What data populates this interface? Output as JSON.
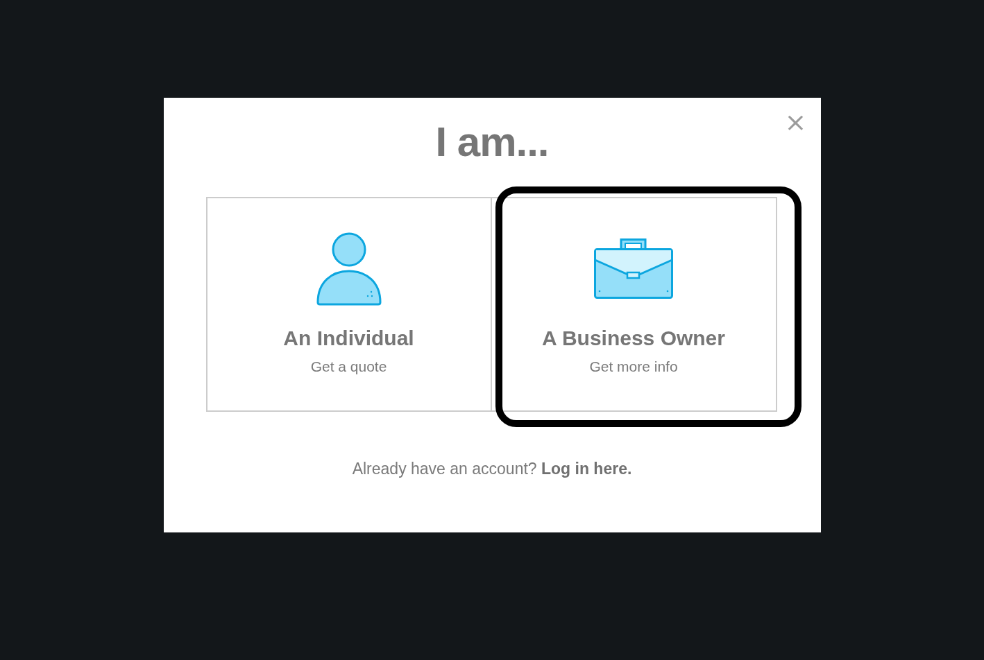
{
  "dialog": {
    "title": "I am...",
    "close": "×"
  },
  "options": [
    {
      "kind": "person",
      "title": "An Individual",
      "subtitle": "Get a quote",
      "selected": false
    },
    {
      "kind": "briefcase",
      "title": "A Business Owner",
      "subtitle": "Get more info",
      "selected": true
    }
  ],
  "footer": {
    "text": "Already have an account?",
    "link": "Log in here."
  }
}
